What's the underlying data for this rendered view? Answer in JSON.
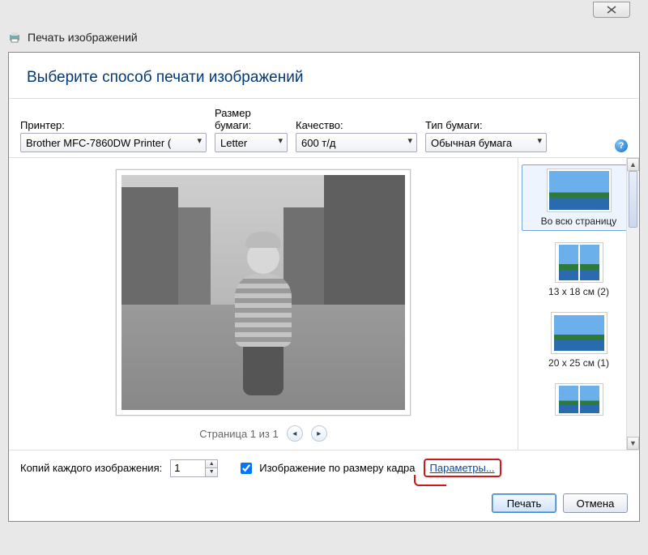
{
  "window": {
    "title": "Печать изображений"
  },
  "header": {
    "title": "Выберите способ печати изображений"
  },
  "options": {
    "printer_label": "Принтер:",
    "printer_value": "Brother MFC-7860DW Printer ( ",
    "paper_label": "Размер бумаги:",
    "paper_value": "Letter",
    "quality_label": "Качество:",
    "quality_value": "600 т/д",
    "type_label": "Тип бумаги:",
    "type_value": "Обычная бумага"
  },
  "pager": {
    "text": "Страница 1 из 1"
  },
  "layouts": {
    "items": [
      {
        "label": "Во всю страницу"
      },
      {
        "label": "13 x 18 см (2)"
      },
      {
        "label": "20 x 25 см (1)"
      },
      {
        "label": ""
      }
    ]
  },
  "bottom": {
    "copies_label": "Копий каждого изображения:",
    "copies_value": "1",
    "fit_label": "Изображение по размеру кадра",
    "params_link": "Параметры..."
  },
  "footer": {
    "print": "Печать",
    "cancel": "Отмена"
  }
}
